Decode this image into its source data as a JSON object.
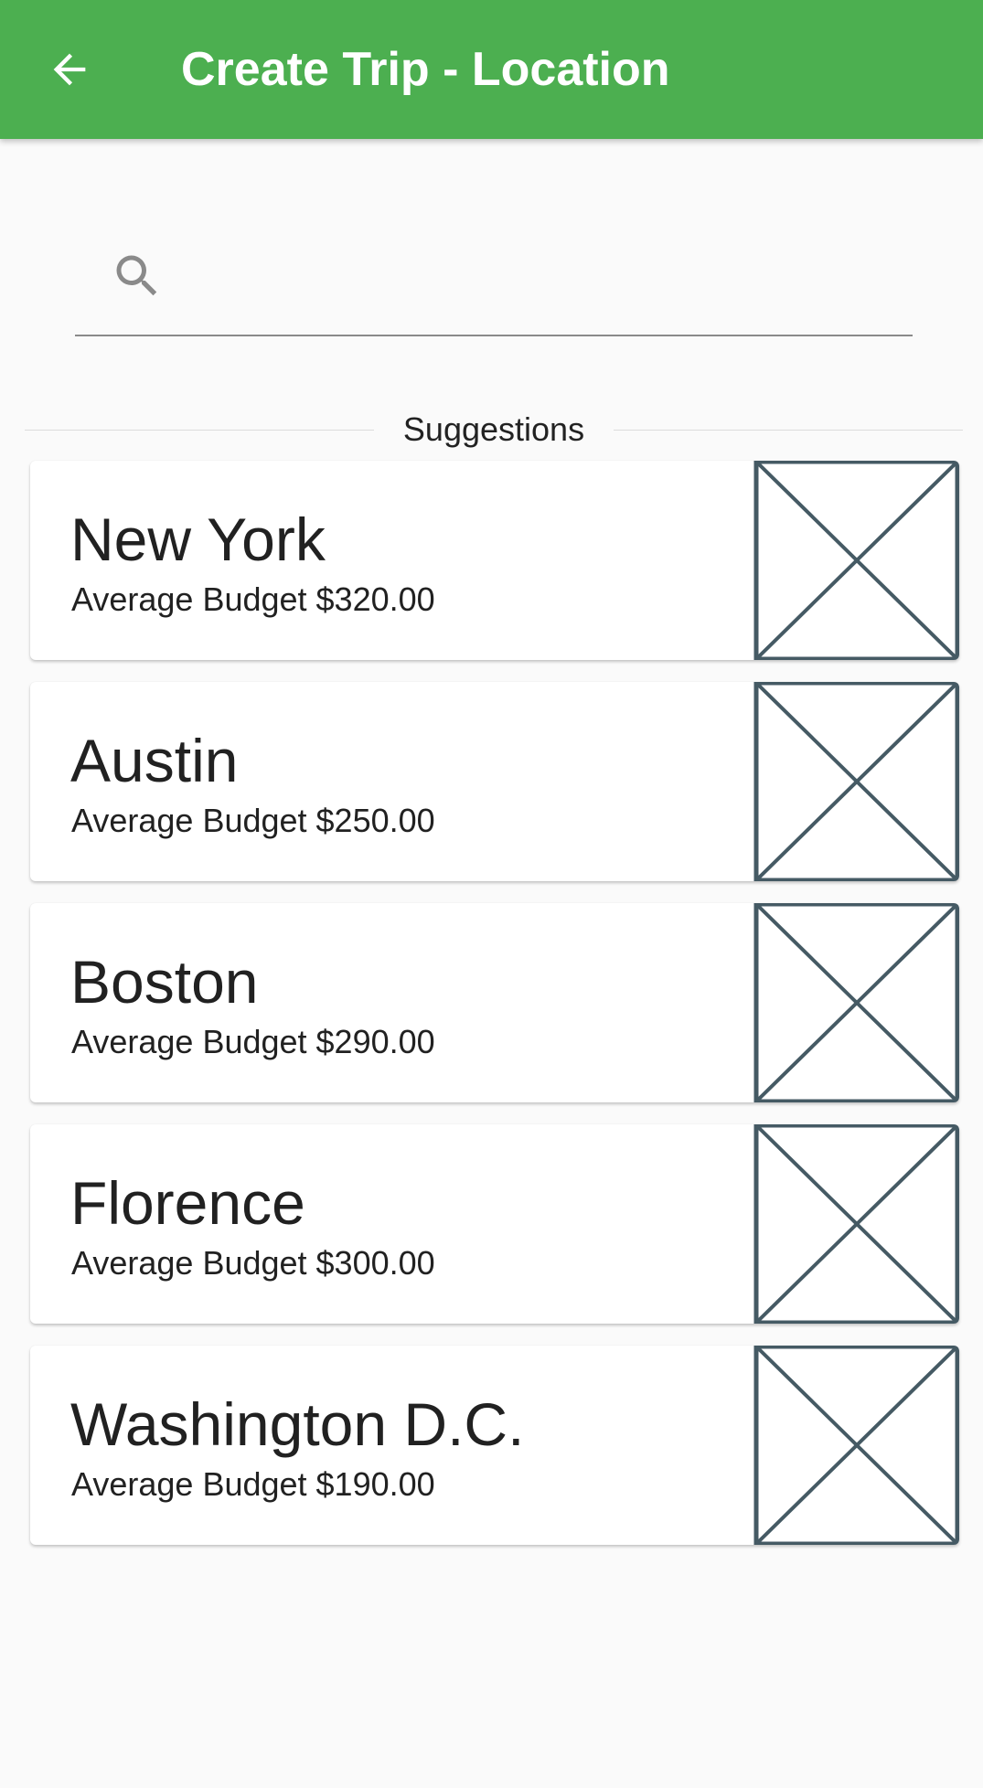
{
  "app_bar": {
    "title": "Create Trip - Location",
    "background": "#4caf50",
    "back_icon": "arrow-back-icon"
  },
  "search": {
    "icon": "search-icon",
    "value": "",
    "placeholder": ""
  },
  "suggestions": {
    "label": "Suggestions",
    "items": [
      {
        "name": "New York",
        "budget": "Average Budget $320.00",
        "image_icon": "image-placeholder-icon"
      },
      {
        "name": "Austin",
        "budget": "Average Budget $250.00",
        "image_icon": "image-placeholder-icon"
      },
      {
        "name": "Boston",
        "budget": "Average Budget $290.00",
        "image_icon": "image-placeholder-icon"
      },
      {
        "name": "Florence",
        "budget": "Average Budget $300.00",
        "image_icon": "image-placeholder-icon"
      },
      {
        "name": "Washington D.C.",
        "budget": "Average Budget $190.00",
        "image_icon": "image-placeholder-icon"
      }
    ]
  }
}
